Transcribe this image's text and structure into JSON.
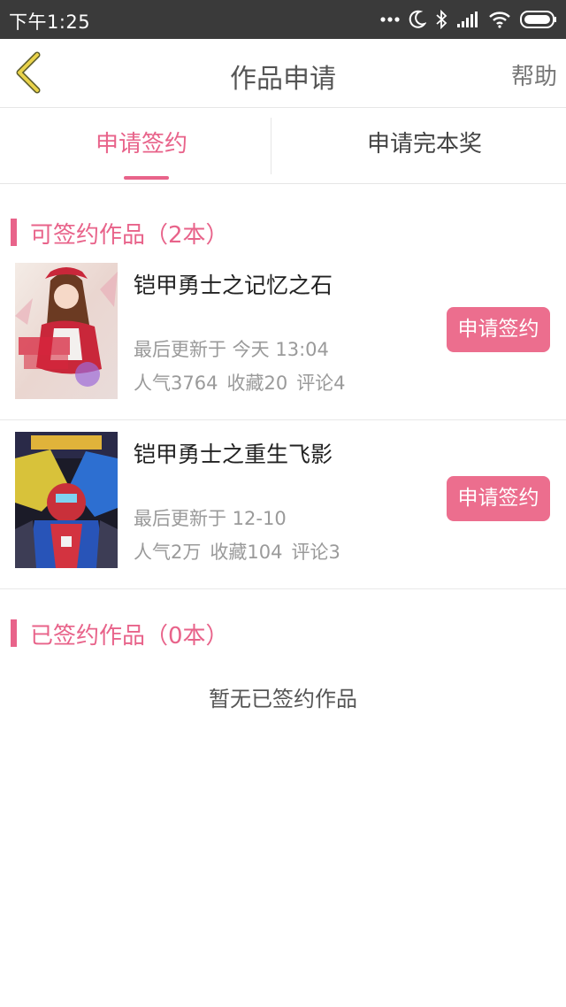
{
  "status_bar": {
    "time": "下午1:25",
    "icons": [
      "more-dots-icon",
      "moon-icon",
      "bluetooth-icon",
      "signal-icon",
      "wifi-icon",
      "battery-icon"
    ]
  },
  "nav": {
    "back_icon": "chevron-left-icon",
    "title": "作品申请",
    "help_label": "帮助"
  },
  "tabs": [
    {
      "label": "申请签约",
      "active": true
    },
    {
      "label": "申请完本奖",
      "active": false
    }
  ],
  "signable_section": {
    "title": "可签约作品（2本）",
    "books": [
      {
        "title": "铠甲勇士之记忆之石",
        "updated": "最后更新于 今天 13:04",
        "popularity": "人气3764",
        "favorites": "收藏20",
        "comments": "评论4",
        "button_label": "申请签约"
      },
      {
        "title": "铠甲勇士之重生飞影",
        "updated": "最后更新于 12-10",
        "popularity": "人气2万",
        "favorites": "收藏104",
        "comments": "评论3",
        "button_label": "申请签约"
      }
    ]
  },
  "signed_section": {
    "title": "已签约作品（0本）",
    "empty_text": "暂无已签约作品"
  },
  "colors": {
    "accent": "#e8638a",
    "button": "#ec6e8e",
    "status_bar": "#3a3a3a"
  }
}
